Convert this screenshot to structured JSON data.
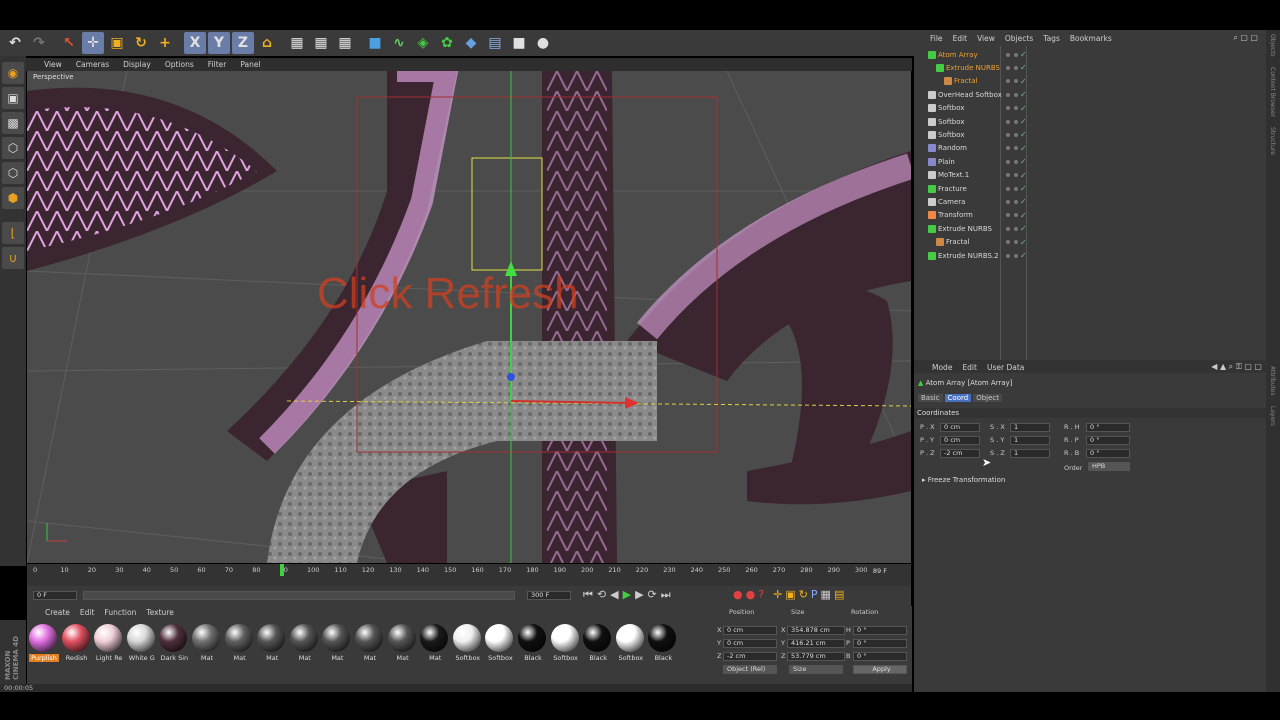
{
  "toolbar": {
    "icons": [
      "undo-icon",
      "redo-icon",
      "select-icon",
      "move-icon",
      "scale-icon",
      "rotate-icon",
      "add-icon",
      "x-axis-icon",
      "y-axis-icon",
      "z-axis-icon",
      "coord-system-icon",
      "render-view-icon",
      "render-picture-icon",
      "render-settings-icon",
      "cube-icon",
      "spline-icon",
      "nurbs-icon",
      "array-icon",
      "deformer-icon",
      "scene-icon",
      "camera-icon",
      "light-icon"
    ],
    "x_label": "X",
    "y_label": "Y",
    "z_label": "Z"
  },
  "viewport": {
    "menu": [
      "View",
      "Cameras",
      "Display",
      "Options",
      "Filter",
      "Panel"
    ],
    "camera_label": "Perspective",
    "overlay_text": "Click Refresh"
  },
  "timeline": {
    "ticks": [
      "0",
      "10",
      "20",
      "30",
      "40",
      "50",
      "60",
      "70",
      "80",
      "90",
      "100",
      "110",
      "120",
      "130",
      "140",
      "150",
      "160",
      "170",
      "180",
      "190",
      "200",
      "210",
      "220",
      "230",
      "240",
      "250",
      "260",
      "270",
      "280",
      "290",
      "300"
    ],
    "current_frame": "89 F",
    "start_field": "0 F",
    "end_field": "300 F",
    "range_end": "300 F"
  },
  "materials": {
    "menu": [
      "Create",
      "Edit",
      "Function",
      "Texture"
    ],
    "items": [
      {
        "label": "Purplish",
        "color": "#e070e0"
      },
      {
        "label": "Redish",
        "color": "#e05060"
      },
      {
        "label": "Light Re",
        "color": "#f0d0d8"
      },
      {
        "label": "White G",
        "color": "#d8d8d8"
      },
      {
        "label": "Dark Sin",
        "color": "#503040"
      },
      {
        "label": "Mat",
        "color": "#707070"
      },
      {
        "label": "Mat",
        "color": "#606060"
      },
      {
        "label": "Mat",
        "color": "#555555"
      },
      {
        "label": "Mat",
        "color": "#555555"
      },
      {
        "label": "Mat",
        "color": "#555555"
      },
      {
        "label": "Mat",
        "color": "#555555"
      },
      {
        "label": "Mat",
        "color": "#555555"
      },
      {
        "label": "Mat",
        "color": "#1a1a1a"
      },
      {
        "label": "Softbox",
        "color": "#f0f0f0"
      },
      {
        "label": "Softbox",
        "color": "#ffffff"
      },
      {
        "label": "Black",
        "color": "#101010"
      },
      {
        "label": "Softbox",
        "color": "#ffffff"
      },
      {
        "label": "Black",
        "color": "#101010"
      },
      {
        "label": "Softbox",
        "color": "#ffffff"
      },
      {
        "label": "Black",
        "color": "#101010"
      }
    ],
    "brand": "MAXON CINEMA 4D"
  },
  "coords": {
    "headers": [
      "Position",
      "Size",
      "Rotation"
    ],
    "rows": [
      {
        "axis": "X",
        "pos": "0 cm",
        "size": "354.878 cm",
        "rot_label": "H",
        "rot": "0 °"
      },
      {
        "axis": "Y",
        "pos": "0 cm",
        "size": "416.21 cm",
        "rot_label": "P",
        "rot": "0 °"
      },
      {
        "axis": "Z",
        "pos": "-2 cm",
        "size": "53.779 cm",
        "rot_label": "B",
        "rot": "0 °"
      }
    ],
    "mode": "Object (Rel)",
    "size_mode": "Size",
    "apply": "Apply"
  },
  "status": {
    "time": "00:00:05"
  },
  "object_manager": {
    "menu": [
      "File",
      "Edit",
      "View",
      "Objects",
      "Tags",
      "Bookmarks"
    ],
    "objects": [
      {
        "name": "Atom Array",
        "sel": true,
        "indent": 0,
        "color": "#4c4"
      },
      {
        "name": "Extrude NURBS",
        "sel": true,
        "indent": 1,
        "color": "#4c4"
      },
      {
        "name": "Fractal",
        "sel": true,
        "indent": 2,
        "color": "#c84"
      },
      {
        "name": "OverHead Softbox",
        "sel": false,
        "indent": 0,
        "color": "#ccc"
      },
      {
        "name": "Softbox",
        "sel": false,
        "indent": 0,
        "color": "#ccc"
      },
      {
        "name": "Softbox",
        "sel": false,
        "indent": 0,
        "color": "#ccc"
      },
      {
        "name": "Softbox",
        "sel": false,
        "indent": 0,
        "color": "#ccc"
      },
      {
        "name": "Random",
        "sel": false,
        "indent": 0,
        "color": "#88c"
      },
      {
        "name": "Plain",
        "sel": false,
        "indent": 0,
        "color": "#88c"
      },
      {
        "name": "MoText.1",
        "sel": false,
        "indent": 0,
        "color": "#ccc"
      },
      {
        "name": "Fracture",
        "sel": false,
        "indent": 0,
        "color": "#4c4"
      },
      {
        "name": "Camera",
        "sel": false,
        "indent": 0,
        "color": "#ccc"
      },
      {
        "name": "Transform",
        "sel": false,
        "indent": 0,
        "color": "#e84"
      },
      {
        "name": "Extrude NURBS",
        "sel": false,
        "indent": 0,
        "color": "#4c4"
      },
      {
        "name": "Fractal",
        "sel": false,
        "indent": 1,
        "color": "#c84"
      },
      {
        "name": "Extrude NURBS.2",
        "sel": false,
        "indent": 0,
        "color": "#4c4"
      }
    ]
  },
  "attributes": {
    "menu": [
      "Mode",
      "Edit",
      "User Data"
    ],
    "title": "Atom Array [Atom Array]",
    "tabs": [
      "Basic",
      "Coord",
      "Object"
    ],
    "active_tab": "Coord",
    "section": "Coordinates",
    "fields": [
      {
        "l1": "P . X",
        "v1": "0 cm",
        "l2": "S . X",
        "v2": "1",
        "l3": "R . H",
        "v3": "0 °"
      },
      {
        "l1": "P . Y",
        "v1": "0 cm",
        "l2": "S . Y",
        "v2": "1",
        "l3": "R . P",
        "v3": "0 °"
      },
      {
        "l1": "P . Z",
        "v1": "-2 cm",
        "l2": "S . Z",
        "v2": "1",
        "l3": "R . B",
        "v3": "0 °"
      }
    ],
    "order_label": "Order",
    "order_value": "HPB",
    "freeze": "Freeze Transformation"
  },
  "side_tabs": [
    "Objects",
    "Content Browser",
    "Structure"
  ],
  "attr_side_tabs": [
    "Attributes",
    "Layers"
  ]
}
